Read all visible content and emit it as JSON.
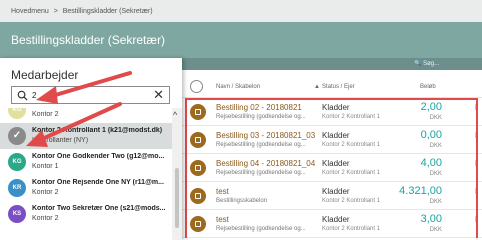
{
  "breadcrumb": {
    "home": "Hovedmenu",
    "sep": ">",
    "current": "Bestillingskladder (Sekretær)"
  },
  "page_title": "Bestillingskladder (Sekretær)",
  "sidebar": {
    "title": "Medarbejder",
    "search": {
      "value": "2"
    },
    "items": [
      {
        "initials": "KG",
        "name": "Kontor 2 Godkender 2 (g2@modst.dk)",
        "sub": "Kontor 2",
        "color": "#e0e0a0",
        "selected": false
      },
      {
        "initials": "",
        "name": "Kontor 2 Kontrollant 1 (k21@modst.dk)",
        "sub": "Kontrollanter (NY)",
        "color": "#8a8a8a",
        "selected": true
      },
      {
        "initials": "KG",
        "name": "Kontor One Godkender Two (g12@mo...",
        "sub": "Kontor 1",
        "color": "#2aa88a",
        "selected": false
      },
      {
        "initials": "KR",
        "name": "Kontor One Rejsende One NY (r11@m...",
        "sub": "Kontor 2",
        "color": "#3b8fc7",
        "selected": false
      },
      {
        "initials": "KS",
        "name": "Kontor Two Sekretær One (s21@mods...",
        "sub": "Kontor 2",
        "color": "#7a4fc4",
        "selected": false
      }
    ]
  },
  "toolbar": {
    "search_placeholder": "Søg..."
  },
  "table": {
    "headers": {
      "name": "Navn / Skabelon",
      "status": "Status / Ejer",
      "amount": "Beløb"
    },
    "rows": [
      {
        "name": "Bestilling 02 - 20180821",
        "template": "Rejsebestilling (godkendelse og...",
        "status": "Kladder",
        "owner": "Kontor 2 Kontrollant 1",
        "amount": "2,00",
        "currency": "DKK",
        "trail": "I"
      },
      {
        "name": "Bestilling 03 - 20180821_03",
        "template": "Rejsebestilling (godkendelse og...",
        "status": "Kladder",
        "owner": "Kontor 2 Kontrollant 1",
        "amount": "0,00",
        "currency": "DKK",
        "trail": "I"
      },
      {
        "name": "Bestilling 04 - 20180821_04",
        "template": "Rejsebestilling (godkendelse og...",
        "status": "Kladder",
        "owner": "Kontor 2 Kontrollant 1",
        "amount": "4,00",
        "currency": "DKK",
        "trail": "I"
      },
      {
        "name": "test",
        "template": "Bestillingsskabelon",
        "status": "Kladder",
        "owner": "Kontor 2 Kontrollant 1",
        "amount": "4.321,00",
        "currency": "DKK",
        "trail": "I"
      },
      {
        "name": "test",
        "template": "Rejsebestilling (godkendelse og...",
        "status": "Kladder",
        "owner": "Kontor 2 Kontrollant 1",
        "amount": "3,00",
        "currency": "DKK",
        "trail": "I"
      }
    ]
  },
  "colors": {
    "header_teal": "#7fa7a2",
    "accent_teal": "#1aa3a3",
    "row_icon": "#9b6a1f",
    "annotation_red": "#e04a4a"
  },
  "icons": {
    "search": "search-icon",
    "clear": "close-icon",
    "row": "document-icon"
  }
}
